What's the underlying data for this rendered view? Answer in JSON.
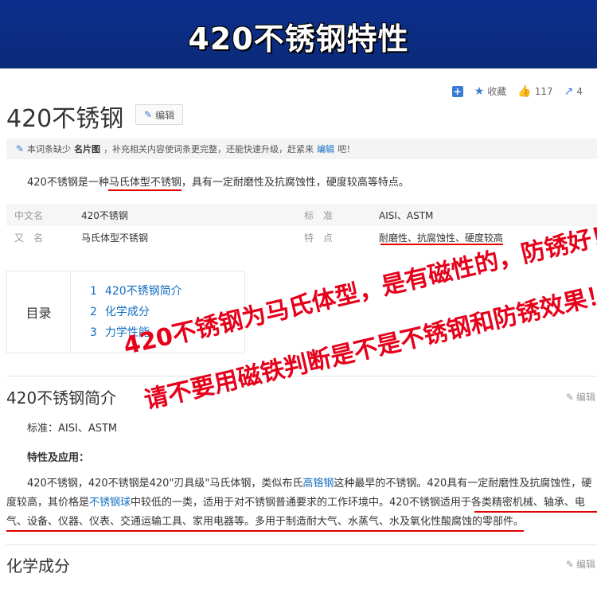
{
  "banner": {
    "title": "420不锈钢特性"
  },
  "toolbar": {
    "favorite": "收藏",
    "likes": "117",
    "shares": "4"
  },
  "article": {
    "title": "420不锈钢",
    "edit_label": "编辑",
    "notice": {
      "pre": "本词条缺少",
      "bold": "名片图",
      "mid": "，补充相关内容使词条更完整，还能快速升级，赶紧来",
      "link": "编辑",
      "post": "吧！"
    },
    "intro": "420不锈钢是一种马氏体型不锈钢，具有一定耐磨性及抗腐蚀性，硬度较高等特点。",
    "info": [
      {
        "k1": "中文名",
        "v1": "420不锈钢",
        "k2": "标　准",
        "v2": "AISI、ASTM"
      },
      {
        "k1": "又　名",
        "v1": "马氏体型不锈钢",
        "k2": "特　点",
        "v2": "耐磨性、抗腐蚀性、硬度较高"
      }
    ],
    "toc": {
      "title": "目录",
      "items": [
        {
          "num": "1",
          "label": "420不锈钢简介"
        },
        {
          "num": "2",
          "label": "化学成分"
        },
        {
          "num": "3",
          "label": "力学性能"
        }
      ]
    },
    "overlay": {
      "line1": "420不锈钢为马氏体型，是有磁性的，防锈好！",
      "line2": "请不要用磁铁判断是不是不锈钢和防锈效果！"
    },
    "section1": {
      "title": "420不锈钢简介",
      "edit": "编辑",
      "standard": "标准：AISI、ASTM",
      "subhead": "特性及应用：",
      "para_a": "420不锈钢，420不锈钢是420\"刃具级\"马氏体钢，类似布氏",
      "para_link1": "高铬钢",
      "para_b": "这种最早的不锈钢。420具有一定耐磨性及抗腐蚀性，硬度较高，其价格是",
      "para_link2": "不锈钢球",
      "para_c": "中较低的一类，适用于对不锈钢普通要求的工作环境中。420不锈钢适用于各类精密机械、轴承、电气、设备、仪器、仪表、交通运输工具、家用电器等。多用于制造耐大气、水蒸气、水及氧化性酸腐蚀的零部件。"
    },
    "section2": {
      "title": "化学成分",
      "edit": "编辑"
    }
  }
}
